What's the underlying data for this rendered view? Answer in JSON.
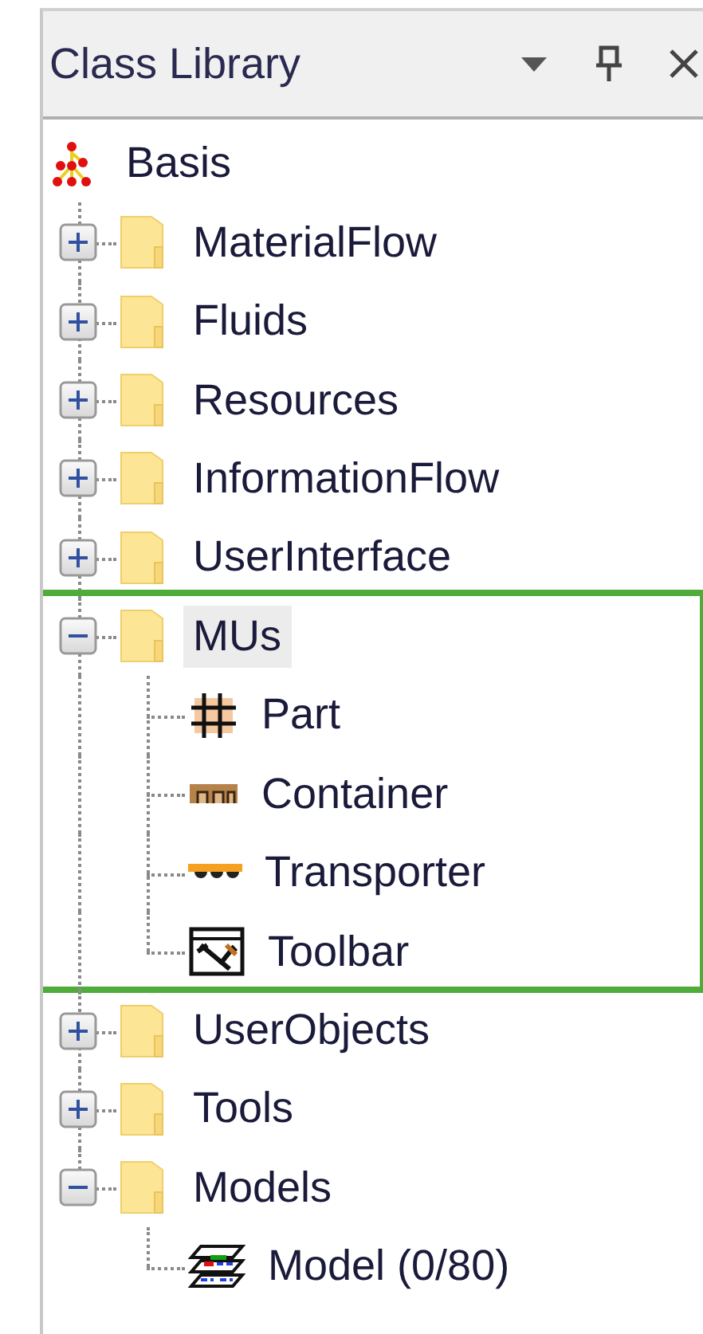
{
  "panel": {
    "title": "Class Library"
  },
  "tree": [
    {
      "label": "Basis",
      "kind": "library",
      "selected": false,
      "children": [
        {
          "label": "MaterialFlow",
          "kind": "folder",
          "expanded": false,
          "selected": false,
          "highlighted": false
        },
        {
          "label": "Fluids",
          "kind": "folder",
          "expanded": false,
          "selected": false,
          "highlighted": false
        },
        {
          "label": "Resources",
          "kind": "folder",
          "expanded": false,
          "selected": false,
          "highlighted": false
        },
        {
          "label": "InformationFlow",
          "kind": "folder",
          "expanded": false,
          "selected": false,
          "highlighted": false
        },
        {
          "label": "UserInterface",
          "kind": "folder",
          "expanded": false,
          "selected": false,
          "highlighted": false
        },
        {
          "label": "MUs",
          "kind": "folder",
          "expanded": true,
          "selected": true,
          "highlighted": true,
          "children": [
            {
              "label": "Part",
              "kind": "part",
              "selected": false
            },
            {
              "label": "Container",
              "kind": "container",
              "selected": false
            },
            {
              "label": "Transporter",
              "kind": "transporter",
              "selected": false
            },
            {
              "label": "Toolbar",
              "kind": "toolbar",
              "selected": false
            }
          ]
        },
        {
          "label": "UserObjects",
          "kind": "folder",
          "expanded": false,
          "selected": false,
          "highlighted": false
        },
        {
          "label": "Tools",
          "kind": "folder",
          "expanded": false,
          "selected": false,
          "highlighted": false
        },
        {
          "label": "Models",
          "kind": "folder",
          "expanded": true,
          "selected": false,
          "highlighted": false,
          "children": [
            {
              "label": "Model (0/80)",
              "kind": "model",
              "selected": false
            }
          ]
        }
      ]
    }
  ]
}
